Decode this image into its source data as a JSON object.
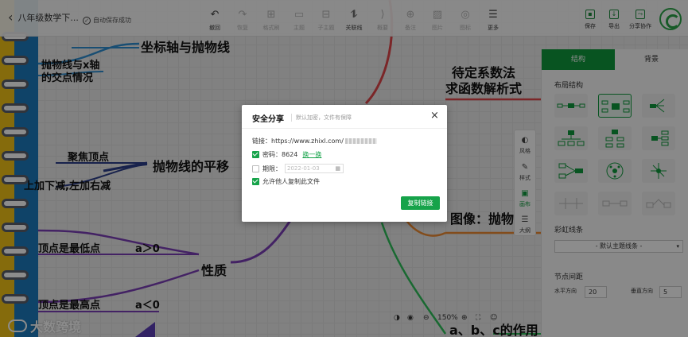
{
  "toolbar": {
    "doc_title": "八年级数学下...",
    "save_status": "自动保存成功",
    "tools": [
      {
        "icon": "undo-icon",
        "glyph": "↶",
        "label": "撤回"
      },
      {
        "icon": "redo-icon",
        "glyph": "↷",
        "label": "恢复"
      },
      {
        "icon": "format-painter-icon",
        "glyph": "⊞",
        "label": "格式刷"
      },
      {
        "icon": "topic-icon",
        "glyph": "▭",
        "label": "主题"
      },
      {
        "icon": "subtopic-icon",
        "glyph": "⊟",
        "label": "子主题"
      },
      {
        "icon": "relation-line-icon",
        "glyph": "⥮",
        "label": "关联线"
      },
      {
        "icon": "summary-icon",
        "glyph": "⟩",
        "label": "概要"
      },
      {
        "icon": "note-icon",
        "glyph": "⊕",
        "label": "备注"
      },
      {
        "icon": "image-icon",
        "glyph": "▨",
        "label": "图片"
      },
      {
        "icon": "badge-icon",
        "glyph": "◎",
        "label": "图标"
      },
      {
        "icon": "more-icon",
        "glyph": "☰",
        "label": "更多"
      }
    ],
    "right_tools": [
      {
        "icon": "save-icon",
        "label": "保存"
      },
      {
        "icon": "export-icon",
        "label": "导出"
      },
      {
        "icon": "share-icon",
        "label": "分享协作"
      }
    ]
  },
  "mindmap": {
    "nodes": [
      "坐标轴与抛物线",
      "抛物线与x轴\n的交点情况",
      "待定系数法\n求函数解析式",
      "聚焦顶点",
      "抛物线的平移",
      "上加下减,左加右减",
      "图像：抛物",
      "顶点是最低点",
      "a＞0",
      "性质",
      "顶点是最高点",
      "a＜0",
      "a、b、c的作用"
    ]
  },
  "panel": {
    "tabs": [
      "结构",
      "背景"
    ],
    "layout_title": "布局结构",
    "rainbow_title": "彩虹线条",
    "rainbow_value": "- 默认主题线条 -",
    "spacing_title": "节点间距",
    "horizontal_label": "水平方向",
    "horizontal_value": "20",
    "vertical_label": "垂直方向",
    "vertical_value": "5"
  },
  "side_strip": [
    "风格",
    "样式",
    "画布",
    "大纲"
  ],
  "zoom": {
    "level": "150%",
    "minus": "⊖",
    "plus": "⊕"
  },
  "watermark": "大数跨境",
  "dialog": {
    "title": "安全分享",
    "subtitle": "默认加密，文件有保障",
    "link_label": "链接：",
    "link_value": "https://www.zhixl.com/",
    "password_label": "密码：",
    "password_value": "8624",
    "change_label": "换一换",
    "expiry_label": "期限：",
    "expiry_placeholder": "2022-01-03",
    "allow_copy_label": "允许他人复制此文件",
    "copy_button": "复制链接",
    "password_checked": true,
    "expiry_checked": false,
    "allow_copy_checked": true
  },
  "colors": {
    "accent_green": "#16a34a",
    "tab_green": "#0f9a3c",
    "notebook_yellow": "#f2c416",
    "notebook_blue": "#1d7bbd",
    "branch_blue": "#2f8fd1",
    "branch_red": "#e0454a",
    "branch_purple": "#7b3fb7",
    "branch_orange": "#ee8a32",
    "branch_green": "#2fbf5a"
  }
}
